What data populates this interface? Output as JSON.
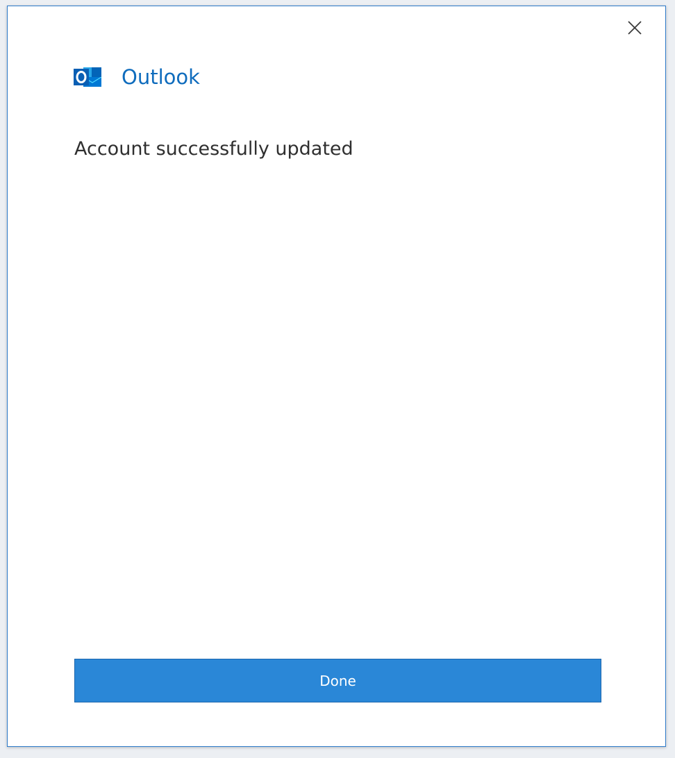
{
  "dialog": {
    "brand": {
      "name": "Outlook",
      "logo_icon": "outlook-logo-icon",
      "brand_color": "#0f6cbd"
    },
    "close_icon": "close-icon",
    "message": "Account successfully updated",
    "done_label": "Done",
    "button_color": "#2a87d7"
  }
}
